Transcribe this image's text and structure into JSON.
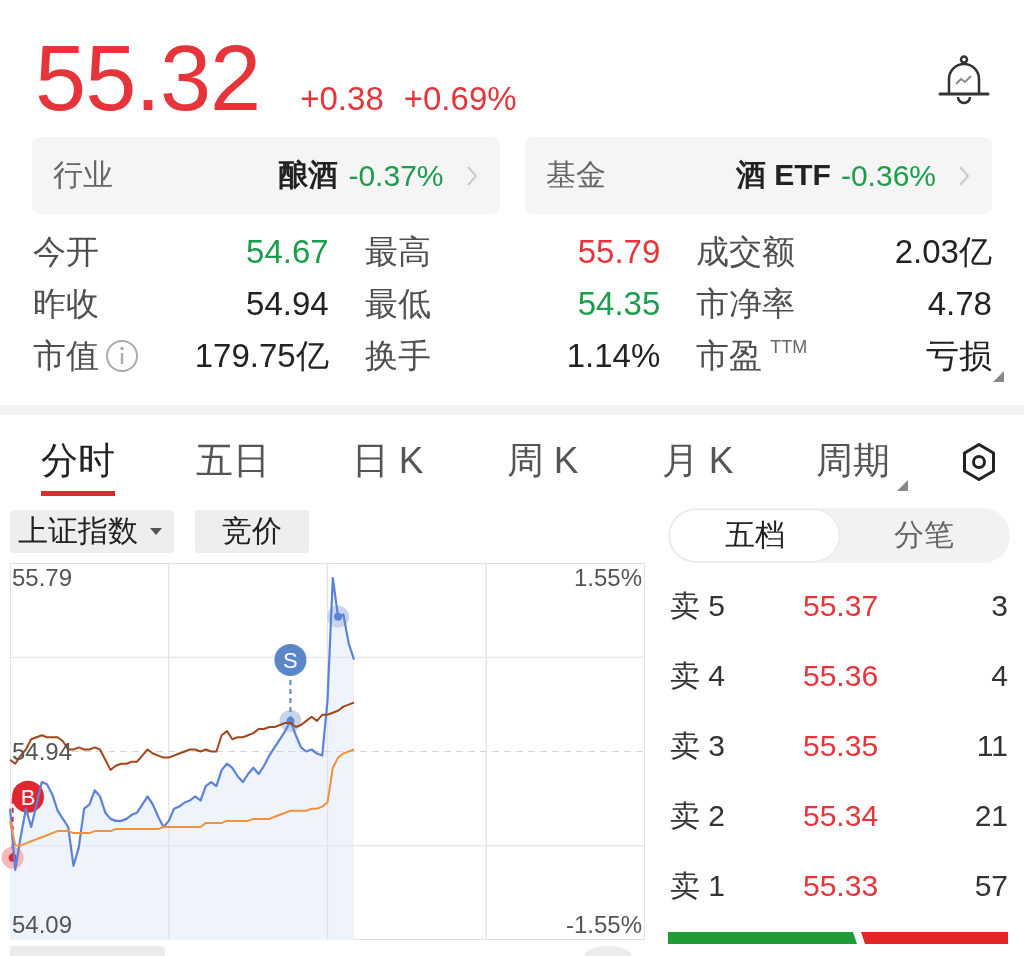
{
  "quote": {
    "price": "55.32",
    "change": "+0.38",
    "change_pct": "+0.69%",
    "color": "#e5353b"
  },
  "related": [
    {
      "label": "行业",
      "name": "酿酒",
      "change": "-0.37%",
      "color": "#1c9d4b"
    },
    {
      "label": "基金",
      "name": "酒 ETF",
      "change": "-0.36%",
      "color": "#1c9d4b"
    }
  ],
  "stats": [
    {
      "label": "今开",
      "value": "54.67",
      "color": "#1c9d4b",
      "kind": "plain"
    },
    {
      "label": "最高",
      "value": "55.79",
      "color": "#e5353b",
      "kind": "plain"
    },
    {
      "label": "成交额",
      "value": "2.03亿",
      "color": "#222222",
      "kind": "plain"
    },
    {
      "label": "昨收",
      "value": "54.94",
      "color": "#222222",
      "kind": "plain"
    },
    {
      "label": "最低",
      "value": "54.35",
      "color": "#1c9d4b",
      "kind": "plain"
    },
    {
      "label": "市净率",
      "value": "4.78",
      "color": "#222222",
      "kind": "plain"
    },
    {
      "label": "市值",
      "value": "179.75亿",
      "color": "#222222",
      "kind": "info"
    },
    {
      "label": "换手",
      "value": "1.14%",
      "color": "#222222",
      "kind": "plain"
    },
    {
      "label": "市盈$^{TTM}$",
      "value": "亏损",
      "color": "#222222",
      "kind": "menu"
    }
  ],
  "tabs": [
    {
      "label": "分时",
      "selected": true,
      "kind": "plain"
    },
    {
      "label": "五日",
      "selected": false,
      "kind": "plain"
    },
    {
      "label": "日 K",
      "selected": false,
      "kind": "plain"
    },
    {
      "label": "周 K",
      "selected": false,
      "kind": "plain"
    },
    {
      "label": "月 K",
      "selected": false,
      "kind": "plain"
    },
    {
      "label": "周期",
      "selected": false,
      "kind": "menu"
    }
  ],
  "chips": [
    {
      "label": "上证指数",
      "kind": "dropdown"
    },
    {
      "label": "竞价",
      "kind": "plain"
    }
  ],
  "chart": {
    "chart_data": {
      "type": "line",
      "categories": [
        null,
        null,
        null,
        null,
        null,
        null,
        null,
        null,
        null,
        null,
        null,
        null,
        null,
        null,
        null,
        null,
        null,
        null,
        null,
        null,
        null,
        null,
        null,
        null,
        null,
        null,
        null,
        null,
        null,
        null,
        null,
        null,
        null,
        null,
        null,
        null,
        null,
        null,
        null,
        null,
        null,
        null,
        null,
        null,
        null,
        null,
        null,
        null,
        null,
        null,
        null,
        null,
        null,
        null,
        null,
        null,
        null,
        null,
        null,
        null,
        null,
        null,
        null,
        null,
        null,
        null,
        null,
        null,
        null,
        null,
        null,
        null,
        null,
        null,
        null,
        null,
        null,
        null,
        null,
        null,
        null,
        null,
        null,
        null,
        null,
        null,
        null,
        null,
        null,
        null,
        null,
        null,
        null,
        null,
        null,
        null,
        null,
        null,
        null,
        null,
        null,
        null,
        null,
        null,
        null,
        null,
        null,
        null,
        null,
        null,
        null,
        null,
        null,
        null,
        null,
        null,
        null,
        null,
        null,
        null,
        null
      ],
      "ylim": [
        54.09,
        55.79
      ],
      "yticks": [
        55.79,
        54.94,
        54.09
      ],
      "grid": true,
      "ref_lines": [
        {
          "axis": "y",
          "value": 54.94
        }
      ],
      "series": [
        {
          "color": "#5a82dc",
          "values": [
            54.66,
            54.36,
            54.52,
            54.66,
            54.57,
            54.68,
            54.79,
            54.78,
            54.73,
            54.65,
            54.61,
            54.57,
            54.38,
            54.47,
            54.66,
            54.68,
            54.75,
            54.72,
            54.64,
            54.61,
            54.6,
            54.6,
            54.61,
            54.63,
            54.64,
            54.68,
            54.72,
            54.68,
            54.62,
            54.57,
            54.6,
            54.66,
            54.67,
            54.69,
            54.7,
            54.72,
            54.7,
            54.77,
            54.79,
            54.77,
            54.85,
            54.88,
            54.86,
            54.82,
            54.79,
            54.83,
            54.86,
            54.83,
            54.87,
            54.92,
            54.96,
            55.0,
            55.04,
            55.09,
            55.02,
            54.96,
            54.94,
            54.95,
            54.93,
            54.92,
            55.19,
            55.79,
            55.6,
            55.61,
            55.47,
            55.39,
            null,
            null,
            null,
            null,
            null,
            null,
            null,
            null,
            null,
            null,
            null,
            null,
            null,
            null,
            null,
            null,
            null,
            null,
            null,
            null,
            null,
            null,
            null,
            null,
            null,
            null,
            null,
            null,
            null,
            null,
            null,
            null,
            null,
            null,
            null,
            null,
            null,
            null,
            null,
            null,
            null,
            null,
            null,
            null,
            null,
            null,
            null,
            null,
            null,
            null,
            null,
            null,
            null,
            null,
            null
          ]
        },
        {
          "color": "#a4461a",
          "values": [
            54.9,
            54.88,
            54.92,
            54.95,
            55.0,
            55.01,
            55.02,
            55.01,
            55.01,
            55.01,
            54.99,
            54.95,
            54.95,
            54.96,
            54.95,
            54.95,
            54.96,
            54.95,
            54.9,
            54.85,
            54.87,
            54.88,
            54.88,
            54.89,
            54.89,
            54.92,
            54.95,
            54.93,
            54.92,
            54.91,
            54.91,
            54.92,
            54.93,
            54.94,
            54.95,
            54.95,
            54.94,
            54.95,
            54.94,
            54.94,
            55.02,
            55.04,
            55.0,
            55.01,
            55.01,
            55.02,
            55.03,
            55.05,
            55.05,
            55.06,
            55.06,
            55.07,
            55.08,
            55.08,
            55.06,
            55.07,
            55.09,
            55.11,
            55.09,
            55.12,
            55.12,
            55.13,
            55.14,
            55.16,
            55.17,
            55.18,
            null,
            null,
            null,
            null,
            null,
            null,
            null,
            null,
            null,
            null,
            null,
            null,
            null,
            null,
            null,
            null,
            null,
            null,
            null,
            null,
            null,
            null,
            null,
            null,
            null,
            null,
            null,
            null,
            null,
            null,
            null,
            null,
            null,
            null,
            null,
            null,
            null,
            null,
            null,
            null,
            null,
            null,
            null,
            null,
            null,
            null,
            null,
            null,
            null,
            null,
            null,
            null,
            null,
            null,
            null
          ]
        },
        {
          "color": "#f0913c",
          "values": [
            54.6,
            54.48,
            54.48,
            54.49,
            54.5,
            54.51,
            54.52,
            54.53,
            54.54,
            54.55,
            54.55,
            54.55,
            54.54,
            54.54,
            54.54,
            54.54,
            54.55,
            54.55,
            54.55,
            54.55,
            54.56,
            54.56,
            54.56,
            54.56,
            54.56,
            54.56,
            54.56,
            54.56,
            54.56,
            54.57,
            54.57,
            54.57,
            54.57,
            54.57,
            54.57,
            54.57,
            54.57,
            54.59,
            54.59,
            54.59,
            54.59,
            54.6,
            54.6,
            54.6,
            54.6,
            54.6,
            54.61,
            54.61,
            54.61,
            54.61,
            54.62,
            54.63,
            54.64,
            54.65,
            54.65,
            54.65,
            54.65,
            54.66,
            54.66,
            54.67,
            54.69,
            54.86,
            54.91,
            54.93,
            54.94,
            54.95,
            null,
            null,
            null,
            null,
            null,
            null,
            null,
            null,
            null,
            null,
            null,
            null,
            null,
            null,
            null,
            null,
            null,
            null,
            null,
            null,
            null,
            null,
            null,
            null,
            null,
            null,
            null,
            null,
            null,
            null,
            null,
            null,
            null,
            null,
            null,
            null,
            null,
            null,
            null,
            null,
            null,
            null,
            null,
            null,
            null,
            null,
            null,
            null,
            null,
            null,
            null,
            null,
            null,
            null,
            null
          ]
        }
      ]
    },
    "percent_labels": [
      "1.55%",
      "-1.55%"
    ],
    "markers": [
      {
        "kind": "buy",
        "label": "B"
      },
      {
        "kind": "sell",
        "label": "S"
      },
      {
        "kind": "point"
      }
    ]
  },
  "order_book": {
    "tabs": [
      {
        "label": "五档",
        "selected": true
      },
      {
        "label": "分笔",
        "selected": false
      }
    ],
    "rows": [
      {
        "label": "卖 5",
        "price": "55.37",
        "volume": "3",
        "color": "#e5353b"
      },
      {
        "label": "卖 4",
        "price": "55.36",
        "volume": "4",
        "color": "#e5353b"
      },
      {
        "label": "卖 3",
        "price": "55.35",
        "volume": "11",
        "color": "#e5353b"
      },
      {
        "label": "卖 2",
        "price": "55.34",
        "volume": "21",
        "color": "#e5353b"
      },
      {
        "label": "卖 1",
        "price": "55.33",
        "volume": "57",
        "color": "#e5353b"
      }
    ],
    "ratio_bar": {
      "level": 0.55
    }
  }
}
